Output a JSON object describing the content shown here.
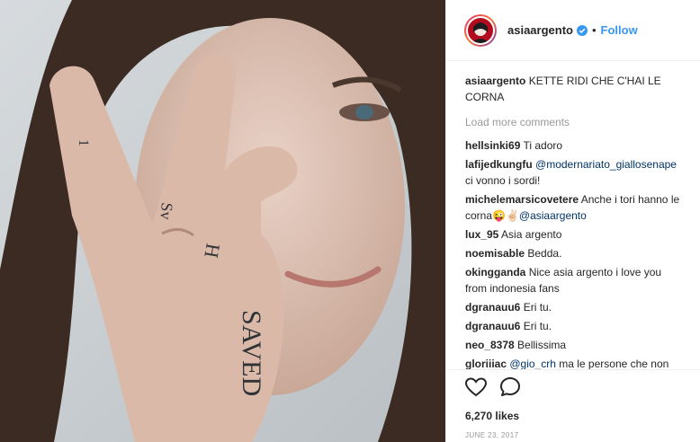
{
  "post": {
    "username": "asiaargento",
    "separator": "•",
    "follow_label": "Follow",
    "caption_text": "KETTE RIDI CHE C'HAI LE CORNA",
    "load_more_label": "Load more comments",
    "likes": "6,270 likes",
    "date": "JUNE 23, 2017",
    "photo_tattoo_text": "SAVED"
  },
  "comments": [
    {
      "user": "hellsinki69",
      "text": "Ti adoro"
    },
    {
      "user": "lafijedkungfu",
      "mention": "@modernariato_giallosenape",
      "text": "ci vonno i sordi!"
    },
    {
      "user": "michelemarsicovetere",
      "text": "Anche i tori hanno le corna😜✌🏻",
      "mention": "@asiaargento"
    },
    {
      "user": "lux_95",
      "text": "Asia argento"
    },
    {
      "user": "noemisable",
      "text": "Bedda."
    },
    {
      "user": "okingganda",
      "text": "Nice asia argento i love you from indonesia fans"
    },
    {
      "user": "dgranauu6",
      "text": "Eri tu."
    },
    {
      "user": "dgranauu6",
      "text": "Eri tu."
    },
    {
      "user": "neo_8378",
      "text": "Bellissima"
    },
    {
      "user": "gloriiiac",
      "mention": "@gio_crh",
      "text": "ma le persone che non sanno cosa vuol dire la frase"
    }
  ],
  "colors": {
    "accent": "#3897f0",
    "verified": "#3897f0"
  },
  "icons": [
    "verified-badge-icon",
    "heart-icon",
    "comment-icon"
  ]
}
